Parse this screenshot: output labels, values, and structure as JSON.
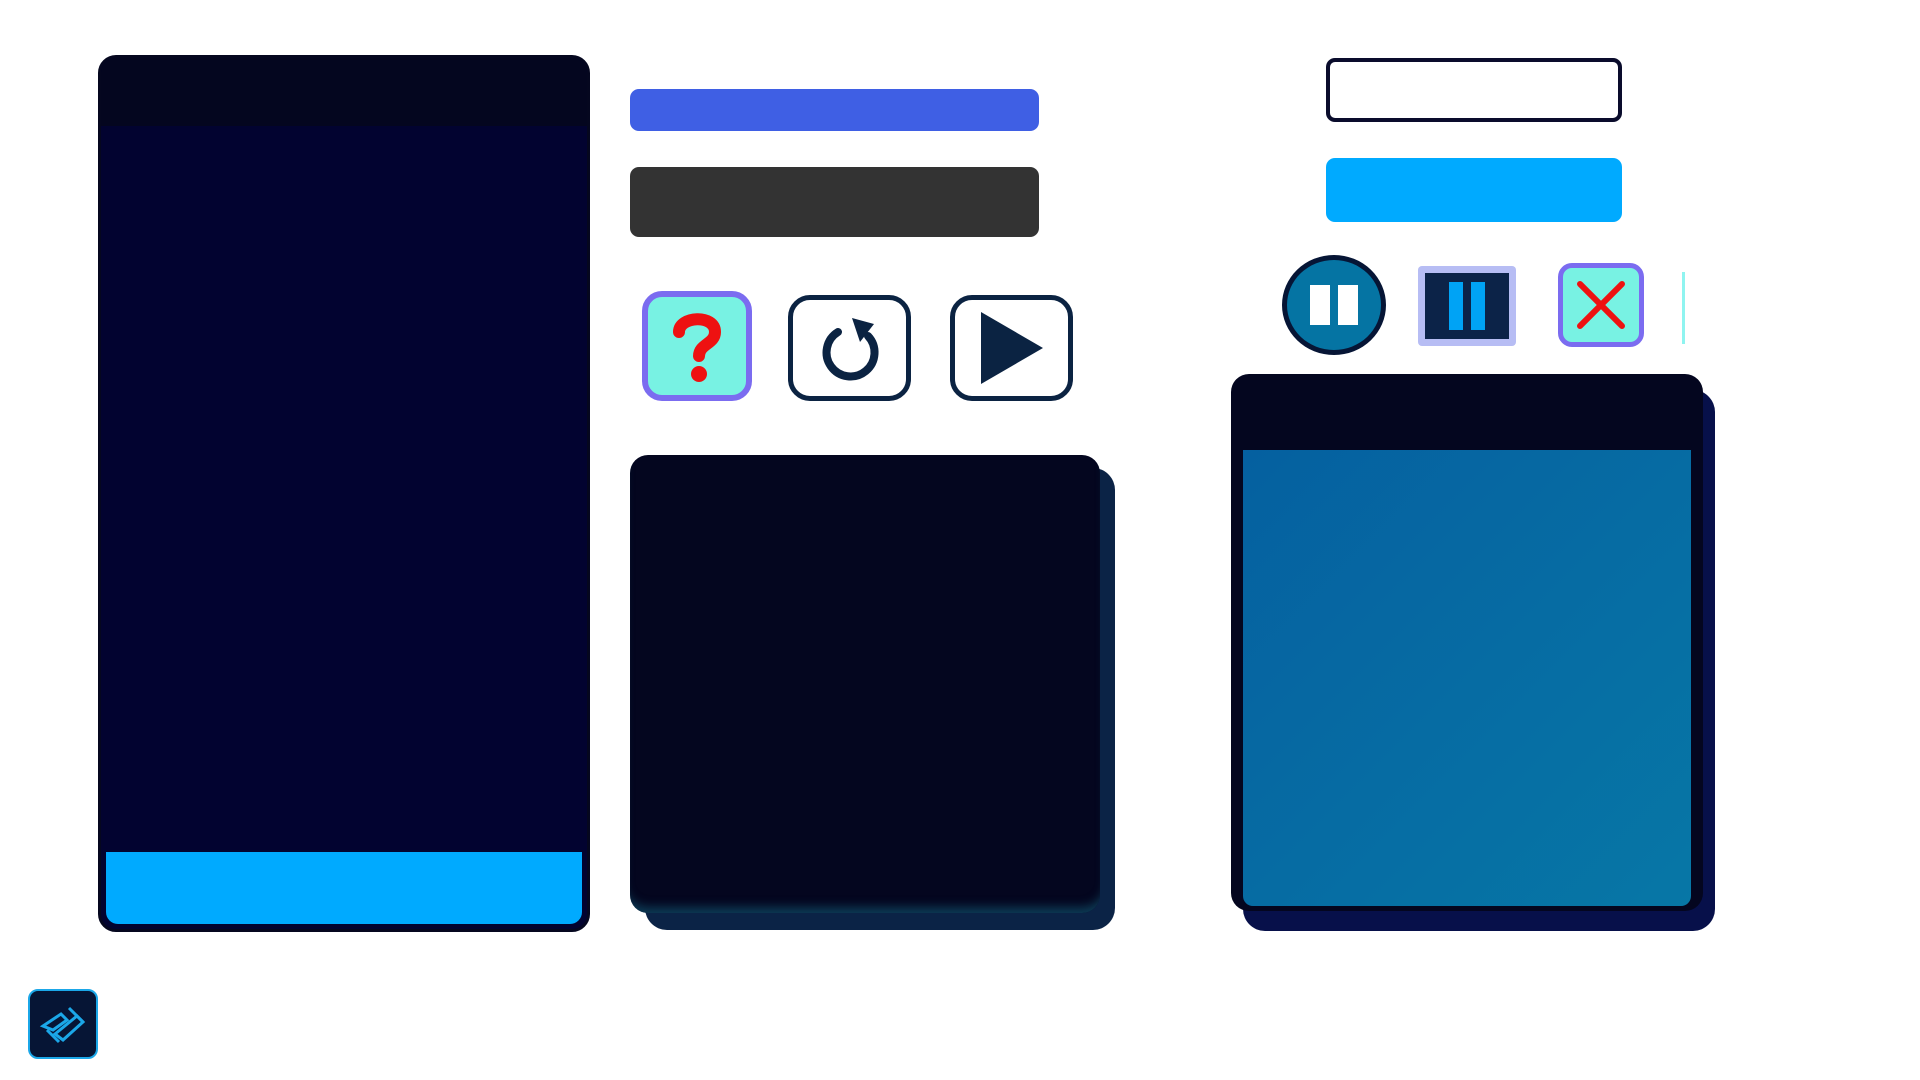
{
  "colors": {
    "background": "#ffffff",
    "panel_dark": "#04061f",
    "panel_navy": "#020330",
    "accent_cyan": "#00aaff",
    "accent_blue": "#3f5fe4",
    "bar_dark": "#333333",
    "button_teal": "#78f2e3",
    "button_border_purple": "#7b6cf0",
    "help_red": "#ee1111",
    "right_panel_blue": "#0574a3"
  },
  "icons": {
    "help": "question-mark-icon",
    "restart": "restart-icon",
    "play": "play-icon",
    "pause_round": "pause-icon",
    "pause_square": "pause-icon",
    "close": "close-icon",
    "logo": "app-logo-icon"
  },
  "left_panel": {
    "title": "",
    "footer_label": ""
  },
  "middle_panel": {
    "title": ""
  },
  "right_panel": {
    "title": ""
  },
  "input": {
    "value": "",
    "placeholder": ""
  },
  "buttons": {
    "blue_bar_label": "",
    "dark_bar_label": "",
    "cyan_label": ""
  }
}
